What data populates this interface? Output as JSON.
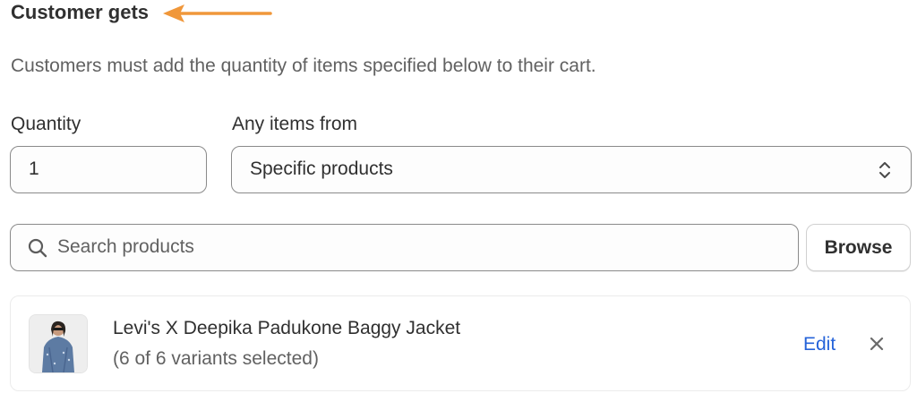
{
  "section": {
    "title": "Customer gets",
    "description": "Customers must add the quantity of items specified below to their cart."
  },
  "quantity": {
    "label": "Quantity",
    "value": "1"
  },
  "items_from": {
    "label": "Any items from",
    "selected": "Specific products"
  },
  "search": {
    "placeholder": "Search products",
    "browse_label": "Browse"
  },
  "product": {
    "title": "Levi's X Deepika Padukone Baggy Jacket",
    "variants": "(6 of 6 variants selected)",
    "edit_label": "Edit"
  },
  "colors": {
    "annotation_arrow": "#f0973a",
    "link": "#2563d9",
    "border": "#8a8a8a"
  },
  "icons": [
    "annotation-arrow-icon",
    "select-chevrons-icon",
    "search-icon",
    "close-icon"
  ]
}
